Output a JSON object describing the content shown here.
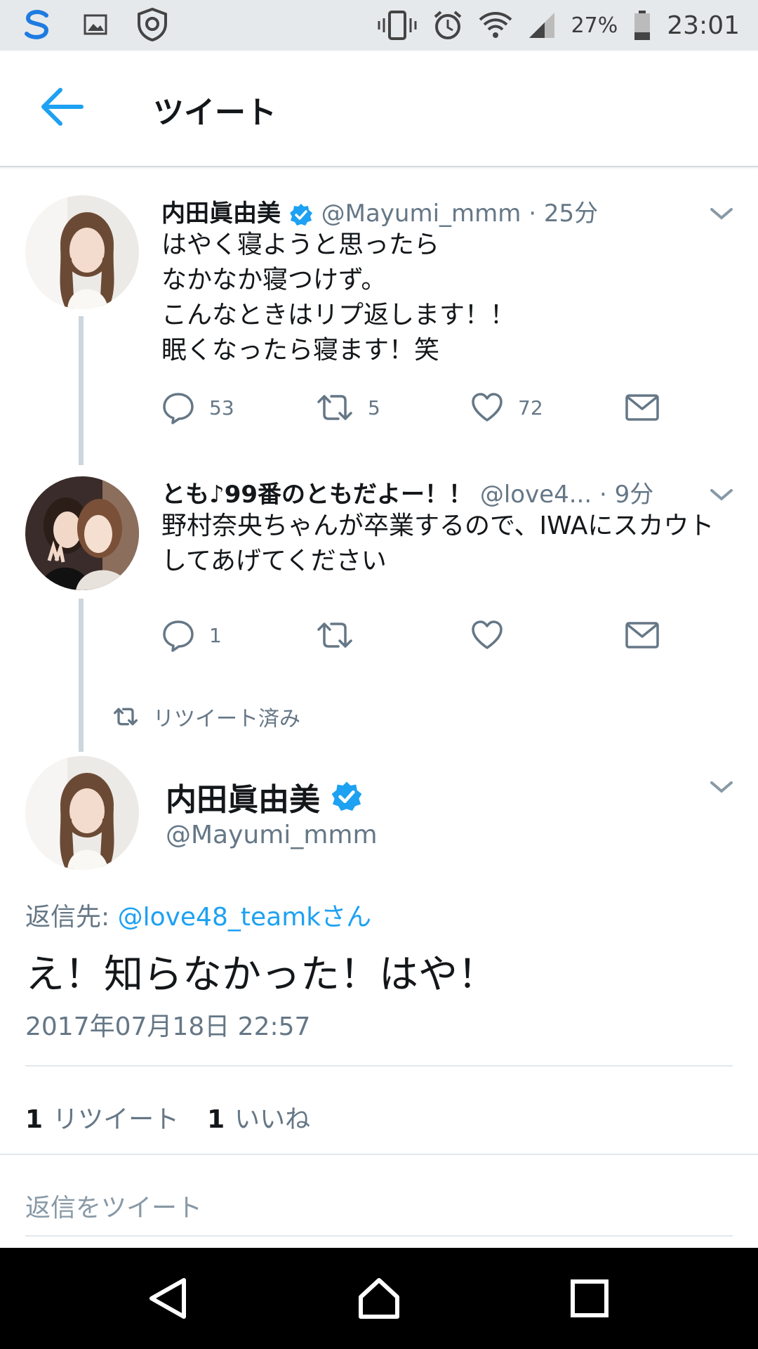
{
  "status_bar": {
    "battery": "27%",
    "time": "23:01",
    "icons": [
      "s-app-icon",
      "gallery-icon",
      "shield-icon",
      "vibrate-icon",
      "alarm-icon",
      "wifi-icon",
      "signal-icon",
      "battery-icon"
    ]
  },
  "header": {
    "title": "ツイート"
  },
  "tweets": [
    {
      "name": "内田眞由美",
      "handle": "@Mayumi_mmm",
      "time": "· 25分",
      "text": "はやく寝ようと思ったら\nなかなか寝つけず。\nこんなときはリプ返します！！\n眠くなったら寝ます！笑",
      "replies": "53",
      "retweets": "5",
      "likes": "72"
    },
    {
      "name": "とも♪99番のともだよー！！",
      "handle": "@love4...",
      "time": "· 9分",
      "text": "野村奈央ちゃんが卒業するので、IWAにスカウト\nしてあげてください",
      "replies": "1",
      "retweets": "",
      "likes": ""
    }
  ],
  "retweeted_label": "リツイート済み",
  "main_tweet": {
    "name": "内田眞由美",
    "handle": "@Mayumi_mmm",
    "reply_prefix": "返信先: ",
    "reply_mention": "@love48_teamkさん",
    "text": "え！知らなかった！はや！",
    "timestamp": "2017年07月18日 22:57",
    "retweet_count": "1",
    "retweet_label": "リツイート",
    "like_count": "1",
    "like_label": "いいね"
  },
  "reply_placeholder": "返信をツイート",
  "colors": {
    "accent": "#1da1f2",
    "secondary_text": "#657786",
    "status_bar_bg": "#e6e9ec"
  }
}
